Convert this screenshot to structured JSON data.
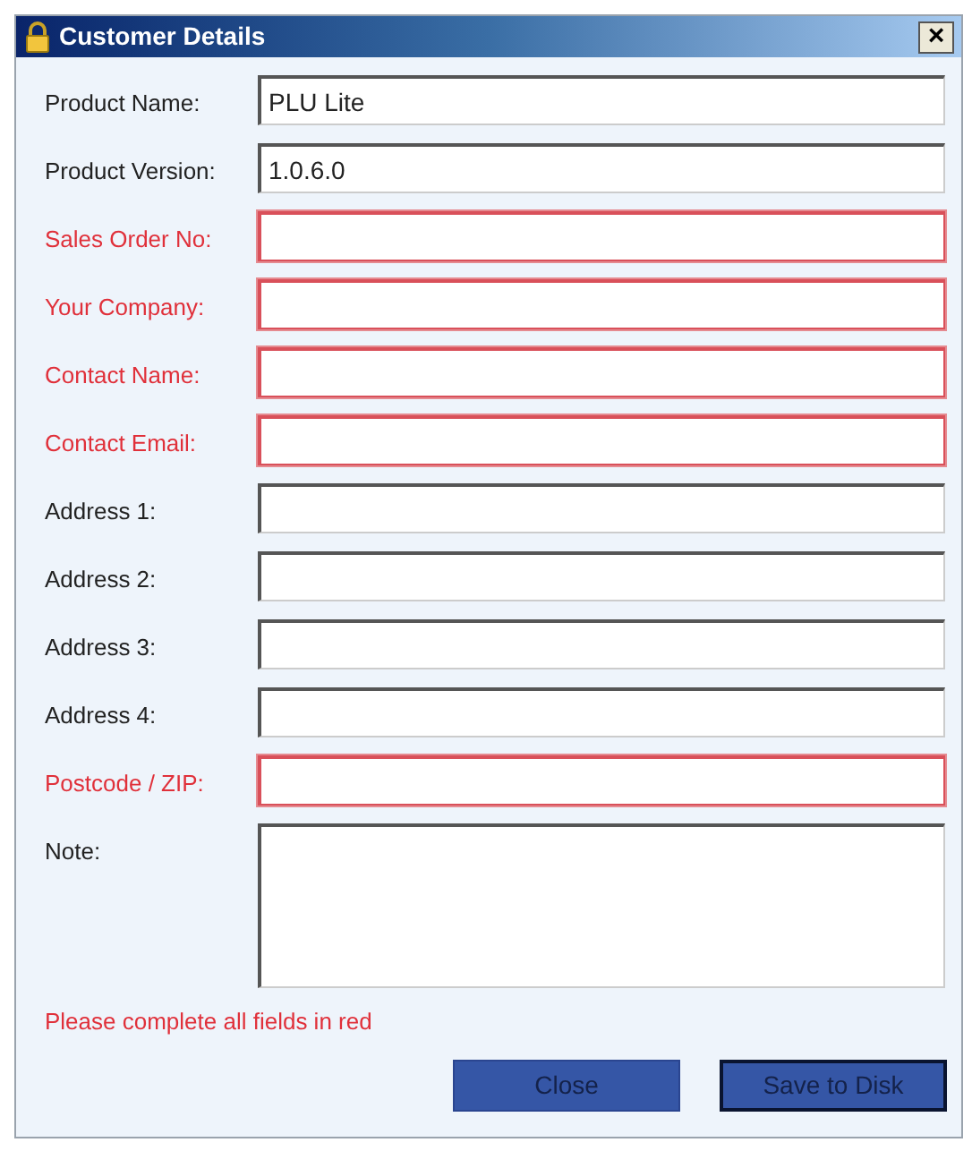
{
  "window": {
    "title": "Customer Details",
    "close": "×"
  },
  "fields": [
    {
      "label": "Product Name:",
      "value": "PLU Lite",
      "required": false,
      "kind": "text"
    },
    {
      "label": "Product Version:",
      "value": "1.0.6.0",
      "required": false,
      "kind": "text"
    },
    {
      "label": "Sales Order No:",
      "required": true,
      "kind": "text"
    },
    {
      "label": "Your Company:",
      "required": true,
      "kind": "text"
    },
    {
      "label": "Contact Name:",
      "required": true,
      "kind": "text"
    },
    {
      "label": "Contact Email:",
      "required": true,
      "kind": "text"
    },
    {
      "label": "Address 1:",
      "required": false,
      "kind": "text"
    },
    {
      "label": "Address 2:",
      "required": false,
      "kind": "text"
    },
    {
      "label": "Address 3:",
      "required": false,
      "kind": "text"
    },
    {
      "label": "Address 4:",
      "required": false,
      "kind": "text"
    },
    {
      "label": "Postcode / ZIP:",
      "required": true,
      "kind": "text"
    },
    {
      "label": "Note:",
      "required": false,
      "kind": "multiline"
    }
  ],
  "message": "Please complete all fields in red",
  "buttons": [
    {
      "label": "Close",
      "default": false
    },
    {
      "label": "Save to Disk",
      "default": true
    }
  ]
}
